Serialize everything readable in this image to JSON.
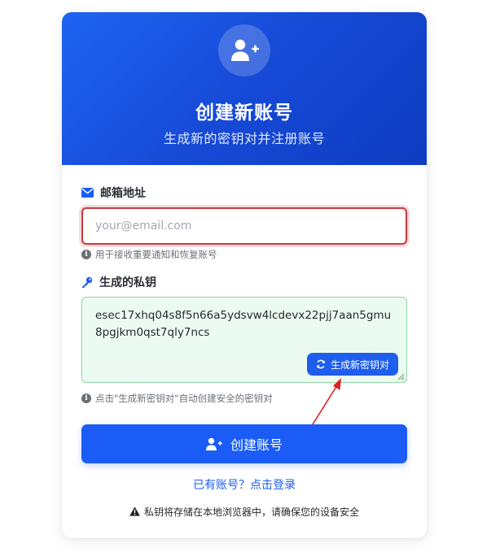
{
  "header": {
    "title": "创建新账号",
    "subtitle": "生成新的密钥对并注册账号",
    "icon": "user-plus-icon"
  },
  "email": {
    "label": "邮箱地址",
    "placeholder": "your@email.com",
    "value": "",
    "hint": "用于接收重要通知和恢复账号",
    "icon": "envelope-icon"
  },
  "private_key": {
    "label": "生成的私钥",
    "value": "esec17xhq04s8f5n66a5ydsvw4lcdevx22pjj7aan5gmu8pgjkm0qst7qly7ncs",
    "regenerate_label": "生成新密钥对",
    "hint": "点击\"生成新密钥对\"自动创建安全的密钥对",
    "icon": "key-icon"
  },
  "submit": {
    "label": "创建账号"
  },
  "login_link": "已有账号？点击登录",
  "warning": "私钥将存储在本地浏览器中，请确保您的设备安全",
  "colors": {
    "primary": "#1a5cf5",
    "header_gradient_start": "#1f63f2",
    "header_gradient_end": "#0f3cc2",
    "error_border": "#c9383e",
    "key_box_bg": "#ecfbf1",
    "key_box_border": "#8fd4a5",
    "annotation_arrow": "#e02020"
  }
}
